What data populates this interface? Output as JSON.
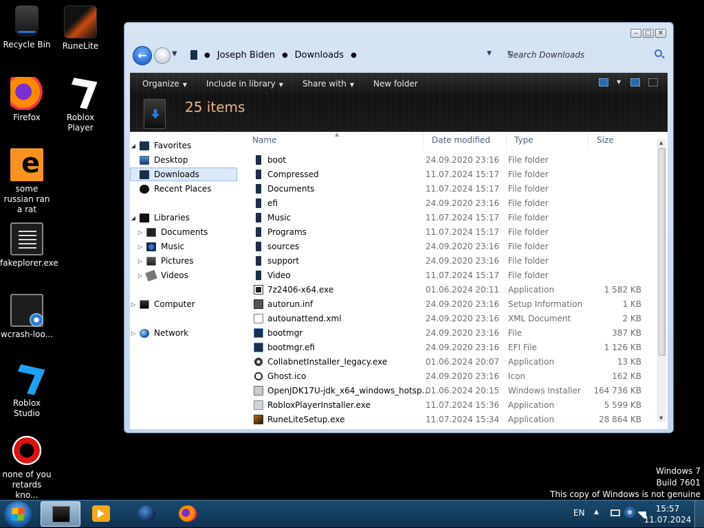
{
  "desktop": {
    "icons": [
      {
        "label": "Recycle Bin",
        "icon": "recycle-bin-icon"
      },
      {
        "label": "RuneLite",
        "icon": "runelite-icon"
      },
      {
        "label": "Firefox",
        "icon": "firefox-icon"
      },
      {
        "label": "Roblox Player",
        "icon": "roblox-player-icon"
      },
      {
        "label": "some russian ran a rat",
        "icon": "rat-icon"
      },
      {
        "label": "fakeplorer.exe",
        "icon": "fakeplorer-icon"
      },
      {
        "label": "wcrash-loo...",
        "icon": "wcrash-icon"
      },
      {
        "label": "Roblox Studio",
        "icon": "roblox-studio-icon"
      },
      {
        "label": "none of you retards kno...",
        "icon": "app-icon"
      }
    ]
  },
  "window": {
    "controls": {
      "minimize": "‒",
      "maximize": "□",
      "close": "✕"
    },
    "breadcrumb": [
      "Joseph Biden",
      "Downloads"
    ],
    "search_placeholder": "Search Downloads",
    "toolbar": {
      "organize": "Organize",
      "include": "Include in library",
      "share": "Share with",
      "new_folder": "New folder"
    },
    "item_count": "25 items",
    "nav": {
      "favorites": "Favorites",
      "desktop": "Desktop",
      "downloads": "Downloads",
      "recent": "Recent Places",
      "libraries": "Libraries",
      "documents": "Documents",
      "music": "Music",
      "pictures": "Pictures",
      "videos": "Videos",
      "computer": "Computer",
      "network": "Network"
    },
    "columns": {
      "name": "Name",
      "date": "Date modified",
      "type": "Type",
      "size": "Size"
    },
    "files": [
      {
        "name": "boot",
        "date": "24.09.2020 23:16",
        "type": "File folder",
        "size": "",
        "icon": "folder"
      },
      {
        "name": "Compressed",
        "date": "11.07.2024 15:17",
        "type": "File folder",
        "size": "",
        "icon": "folder"
      },
      {
        "name": "Documents",
        "date": "11.07.2024 15:17",
        "type": "File folder",
        "size": "",
        "icon": "folder"
      },
      {
        "name": "efi",
        "date": "24.09.2020 23:16",
        "type": "File folder",
        "size": "",
        "icon": "folder"
      },
      {
        "name": "Music",
        "date": "11.07.2024 15:17",
        "type": "File folder",
        "size": "",
        "icon": "folder"
      },
      {
        "name": "Programs",
        "date": "11.07.2024 15:17",
        "type": "File folder",
        "size": "",
        "icon": "folder"
      },
      {
        "name": "sources",
        "date": "24.09.2020 23:16",
        "type": "File folder",
        "size": "",
        "icon": "folder"
      },
      {
        "name": "support",
        "date": "24.09.2020 23:16",
        "type": "File folder",
        "size": "",
        "icon": "folder"
      },
      {
        "name": "Video",
        "date": "11.07.2024 15:17",
        "type": "File folder",
        "size": "",
        "icon": "folder"
      },
      {
        "name": "7z2406-x64.exe",
        "date": "01.06.2024 20:11",
        "type": "Application",
        "size": "1 582 KB",
        "icon": "app"
      },
      {
        "name": "autorun.inf",
        "date": "24.09.2020 23:16",
        "type": "Setup Information",
        "size": "1 KB",
        "icon": "inf"
      },
      {
        "name": "autounattend.xml",
        "date": "24.09.2020 23:16",
        "type": "XML Document",
        "size": "2 KB",
        "icon": "xml"
      },
      {
        "name": "bootmgr",
        "date": "24.09.2020 23:16",
        "type": "File",
        "size": "387 KB",
        "icon": "efi"
      },
      {
        "name": "bootmgr.efi",
        "date": "24.09.2020 23:16",
        "type": "EFI File",
        "size": "1 126 KB",
        "icon": "efi"
      },
      {
        "name": "CollabnetInstaller_legacy.exe",
        "date": "01.06.2024 20:07",
        "type": "Application",
        "size": "13 KB",
        "icon": "gear"
      },
      {
        "name": "Ghost.ico",
        "date": "24.09.2020 23:16",
        "type": "Icon",
        "size": "162 KB",
        "icon": "ghost"
      },
      {
        "name": "OpenJDK17U-jdk_x64_windows_hotspot_...",
        "date": "01.06.2024 20:15",
        "type": "Windows Installer ...",
        "size": "164 736 KB",
        "icon": "msi"
      },
      {
        "name": "RobloxPlayerInstaller.exe",
        "date": "11.07.2024 15:36",
        "type": "Application",
        "size": "5 599 KB",
        "icon": "rbx"
      },
      {
        "name": "RuneLiteSetup.exe",
        "date": "11.07.2024 15:34",
        "type": "Application",
        "size": "28 864 KB",
        "icon": "rune"
      }
    ]
  },
  "watermark": {
    "line1": "Windows 7",
    "line2": "Build 7601",
    "line3": "This copy of Windows is not genuine"
  },
  "taskbar": {
    "lang": "EN",
    "time": "15:57",
    "date": "11.07.2024"
  }
}
